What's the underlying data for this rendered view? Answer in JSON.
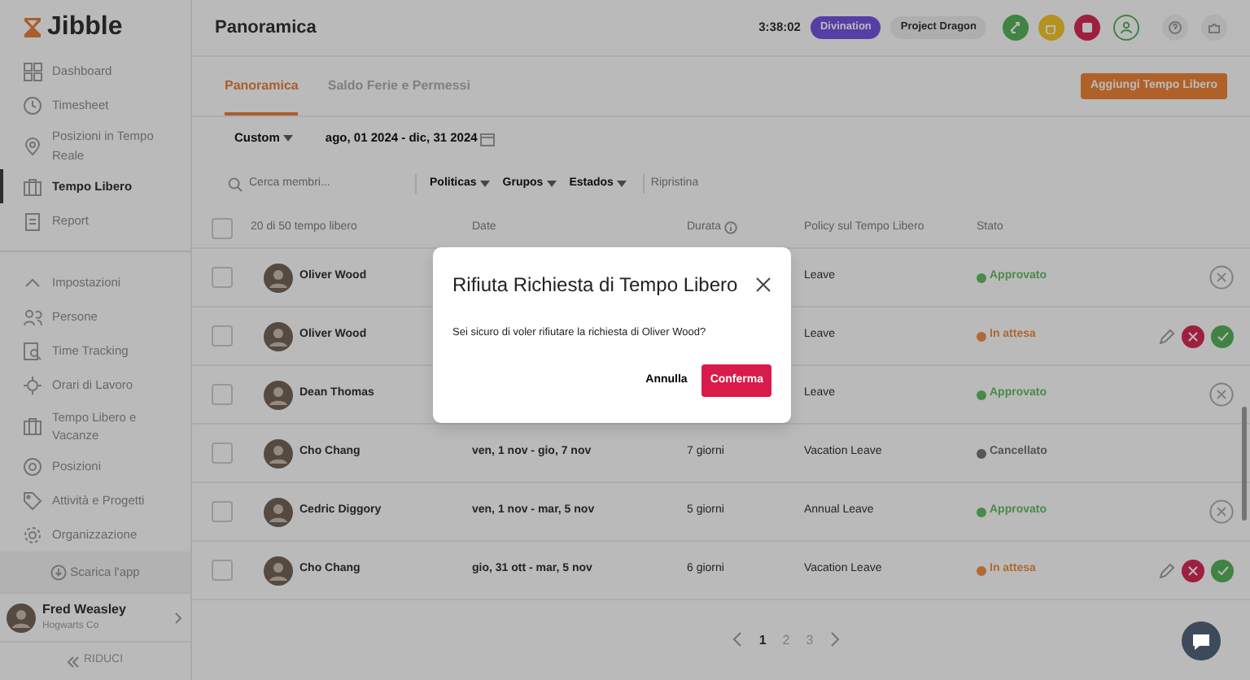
{
  "app": {
    "logo": "Jibble"
  },
  "sidebar": {
    "items": [
      {
        "label": "Dashboard",
        "selected": false
      },
      {
        "label": "Timesheet",
        "selected": false
      },
      {
        "label": "Posizioni in Tempo Reale",
        "selected": false
      },
      {
        "label": "Tempo Libero",
        "selected": true
      },
      {
        "label": "Report",
        "selected": false
      }
    ],
    "settings": {
      "label": "Impostazioni",
      "expanded": true,
      "items": [
        "Persone",
        "Time Tracking",
        "Orari di Lavoro",
        "Tempo Libero e Vacanze",
        "Posizioni",
        "Attività e Progetti",
        "Organizzazione"
      ]
    },
    "download": "Scarica l'app",
    "user": {
      "name": "Fred Weasley",
      "org": "Hogwarts Co"
    },
    "collapse": "RIDUCI"
  },
  "header": {
    "title": "Panoramica",
    "timer": "3:38:02",
    "activity": "Divination",
    "project": "Project Dragon"
  },
  "tabs": [
    {
      "label": "Panoramica",
      "selected": true
    },
    {
      "label": "Saldo Ferie e Permessi",
      "selected": false
    }
  ],
  "add_button": "Aggiungi Tempo Libero",
  "range": {
    "preset": "Custom",
    "dates": "ago, 01 2024 - dic, 31 2024"
  },
  "search": {
    "placeholder": "Cerca membri..."
  },
  "filters": [
    "Politicas",
    "Grupos",
    "Estados"
  ],
  "reset": "Ripristina",
  "table": {
    "select_all": {
      "checked": false
    },
    "columns": [
      "20 di 50 tempo libero",
      "Date",
      "Durata",
      "Policy sul Tempo Libero",
      "Stato"
    ],
    "rows": [
      {
        "checked": false,
        "name": "Oliver Wood",
        "policy": "Leave",
        "status": "Approvato",
        "color": "#4b8a4b",
        "kind": "cancel"
      },
      {
        "checked": false,
        "name": "Oliver Wood",
        "policy": "Leave",
        "status": "In attesa",
        "color": "#b06934",
        "kind": "review"
      },
      {
        "checked": false,
        "name": "Dean Thomas",
        "policy": "Leave",
        "status": "Approvato",
        "color": "#4b8a4b",
        "kind": "cancel"
      },
      {
        "checked": false,
        "name": "Cho Chang",
        "date": "ven, 1 nov - gio, 7 nov",
        "duration": "7 giorni",
        "policy": "Vacation Leave",
        "status": "Cancellato",
        "color": "#565656",
        "kind": "none"
      },
      {
        "checked": false,
        "name": "Cedric Diggory",
        "date": "ven, 1 nov - mar, 5 nov",
        "duration": "5 giorni",
        "policy": "Annual Leave",
        "status": "Approvato",
        "color": "#4b8a4b",
        "kind": "cancel"
      },
      {
        "checked": false,
        "name": "Cho Chang",
        "date": "gio, 31 ott - mar, 5 nov",
        "duration": "6 giorni",
        "policy": "Vacation Leave",
        "status": "In attesa",
        "color": "#b06934",
        "kind": "review"
      }
    ]
  },
  "pagination": [
    {
      "label": "1",
      "selected": true
    },
    {
      "label": "2",
      "selected": false
    },
    {
      "label": "3",
      "selected": false
    }
  ],
  "modal": {
    "title": "Rifiuta Richiesta di Tempo Libero",
    "message": "Sei sicuro di voler rifiutare la richiesta di Oliver Wood?",
    "cancel": "Annulla",
    "confirm": "Conferma"
  }
}
